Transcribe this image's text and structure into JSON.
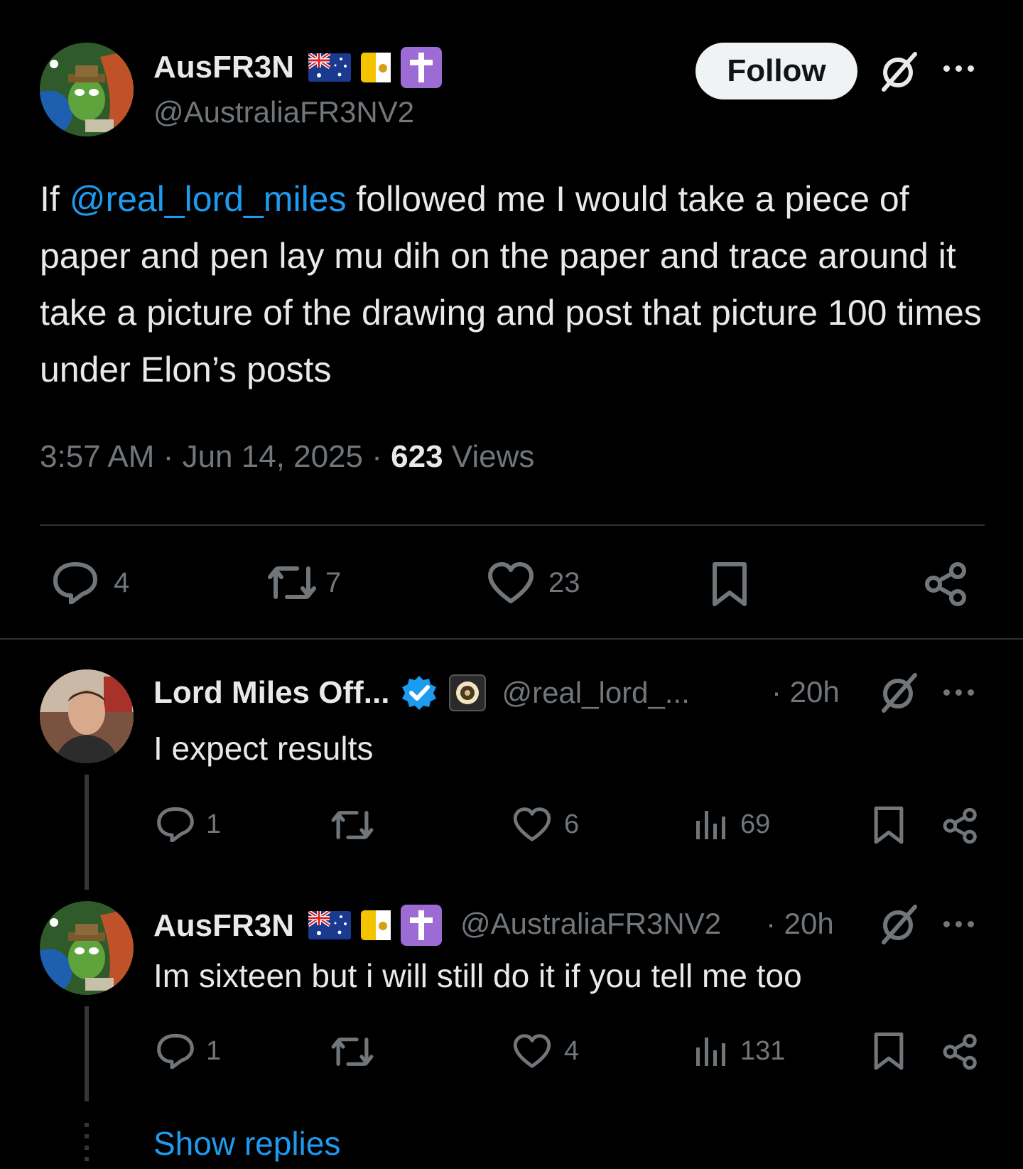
{
  "tweet": {
    "author": {
      "display_name": "AusFR3N",
      "handle": "@AustraliaFR3NV2"
    },
    "follow_label": "Follow",
    "text_prefix": "If ",
    "mention": "@real_lord_miles",
    "text_rest": " followed me I would take a piece of paper and pen lay mu dih on the paper and trace around it take a picture of the drawing and post that picture 100 times under Elon’s posts",
    "time": "3:57 AM",
    "date": "Jun 14, 2025",
    "views_count": "623",
    "views_label": "Views",
    "dot": "·",
    "actions": {
      "replies": "4",
      "reposts": "7",
      "likes": "23"
    }
  },
  "replies": [
    {
      "display_name": "Lord Miles Off...",
      "handle": "@real_lord_...",
      "time": "· 20h",
      "text": "I expect results",
      "actions": {
        "replies": "1",
        "likes": "6",
        "views": "69"
      }
    },
    {
      "display_name": "AusFR3N",
      "handle": "@AustraliaFR3NV2",
      "time": "· 20h",
      "text": "Im sixteen but i will still do it if you tell me too",
      "actions": {
        "replies": "1",
        "likes": "4",
        "views": "131"
      }
    }
  ],
  "show_replies_label": "Show replies",
  "colors": {
    "accent": "#1d9bf0",
    "background": "#000000",
    "muted": "#71767b",
    "verified": "#1d9bf0",
    "cross_badge": "#9d6bd4"
  },
  "icons": [
    "reply-icon",
    "repost-icon",
    "like-icon",
    "bookmark-icon",
    "share-icon",
    "views-icon",
    "grok-icon",
    "more-icon",
    "verified-icon",
    "australia-flag-icon",
    "vatican-flag-icon",
    "cross-icon"
  ]
}
